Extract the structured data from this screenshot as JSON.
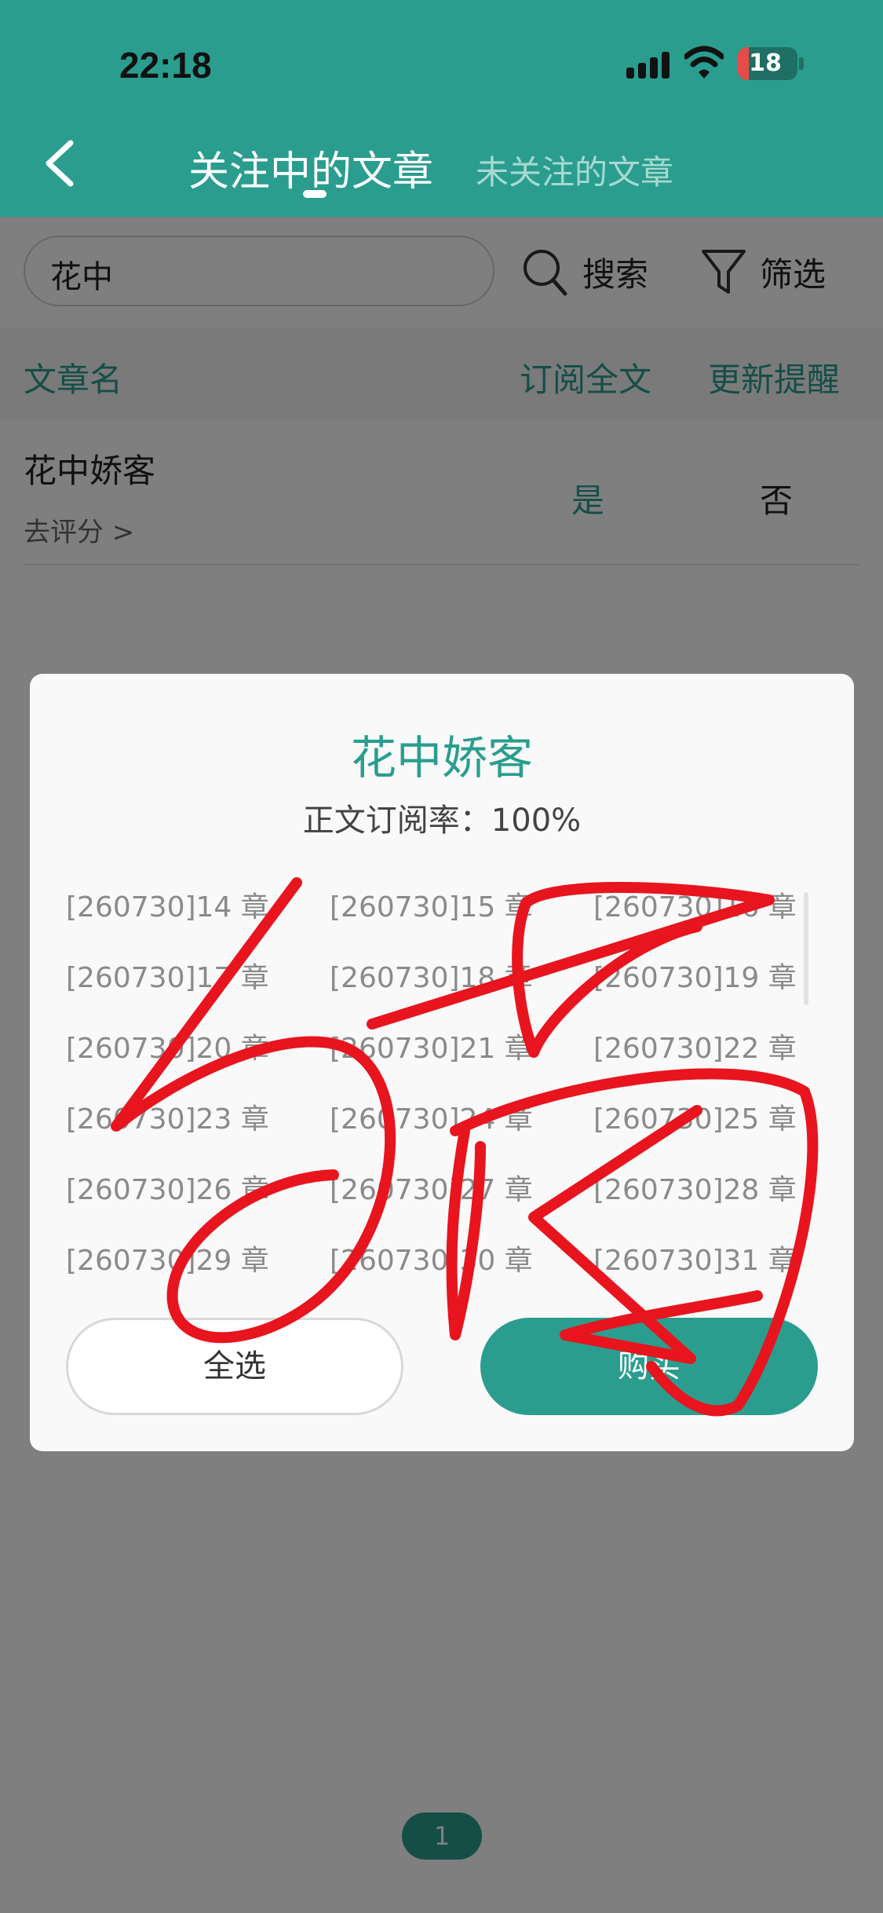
{
  "status_bar": {
    "time": "22:18",
    "battery": "18"
  },
  "header": {
    "tab_active": "关注中的文章",
    "tab_inactive": "未关注的文章",
    "accent_color": "#2a9d8f"
  },
  "search": {
    "value": "花中",
    "search_label": "搜索",
    "filter_label": "筛选"
  },
  "table": {
    "columns": [
      "文章名",
      "订阅全文",
      "更新提醒"
    ],
    "rows": [
      {
        "title": "花中娇客",
        "rate_link": "去评分 >",
        "subscribe_full": "是",
        "update_reminder": "否"
      }
    ]
  },
  "pagination": {
    "current": "1"
  },
  "modal": {
    "title": "花中娇客",
    "subscription_rate": "正文订阅率：100%",
    "chapters": [
      "[260730]14 章",
      "[260730]15 章",
      "[260730]16 章",
      "[260730]17 章",
      "[260730]18 章",
      "[260730]19 章",
      "[260730]20 章",
      "[260730]21 章",
      "[260730]22 章",
      "[260730]23 章",
      "[260730]24 章",
      "[260730]25 章",
      "[260730]26 章",
      "[260730]27 章",
      "[260730]28 章",
      "[260730]29 章",
      "[260730]30 章",
      "[260730]31 章"
    ],
    "select_all_label": "全选",
    "buy_label": "购买"
  },
  "annotation": {
    "stroke_color": "#e8141e"
  }
}
